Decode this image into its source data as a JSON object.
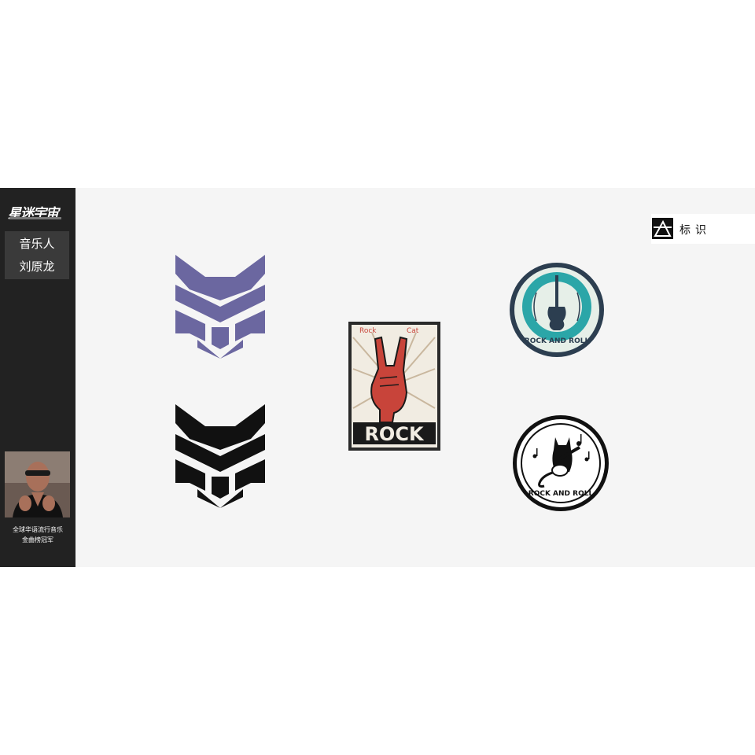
{
  "sidebar": {
    "brand": "星迷宇宙",
    "artist_role": "音乐人",
    "artist_name": "刘原龙",
    "caption_line1": "全球华语流行音乐",
    "caption_line2": "金曲榜冠军"
  },
  "header": {
    "label": "标识"
  },
  "logos": {
    "rock_cat_top_left": "Rock",
    "rock_cat_top_right": "Cat",
    "rock_cat_word": "ROCK",
    "badge_teal_text": "ROCK AND ROLL",
    "badge_cat_text": "ROCK AND ROLL"
  },
  "colors": {
    "sidebar_bg": "#222222",
    "slide_bg": "#f5f5f5",
    "wolf_purple": "#6b67a0",
    "wolf_black": "#111111",
    "rock_red": "#c8443a",
    "teal": "#2ba6a8",
    "navy": "#2c3e50"
  }
}
